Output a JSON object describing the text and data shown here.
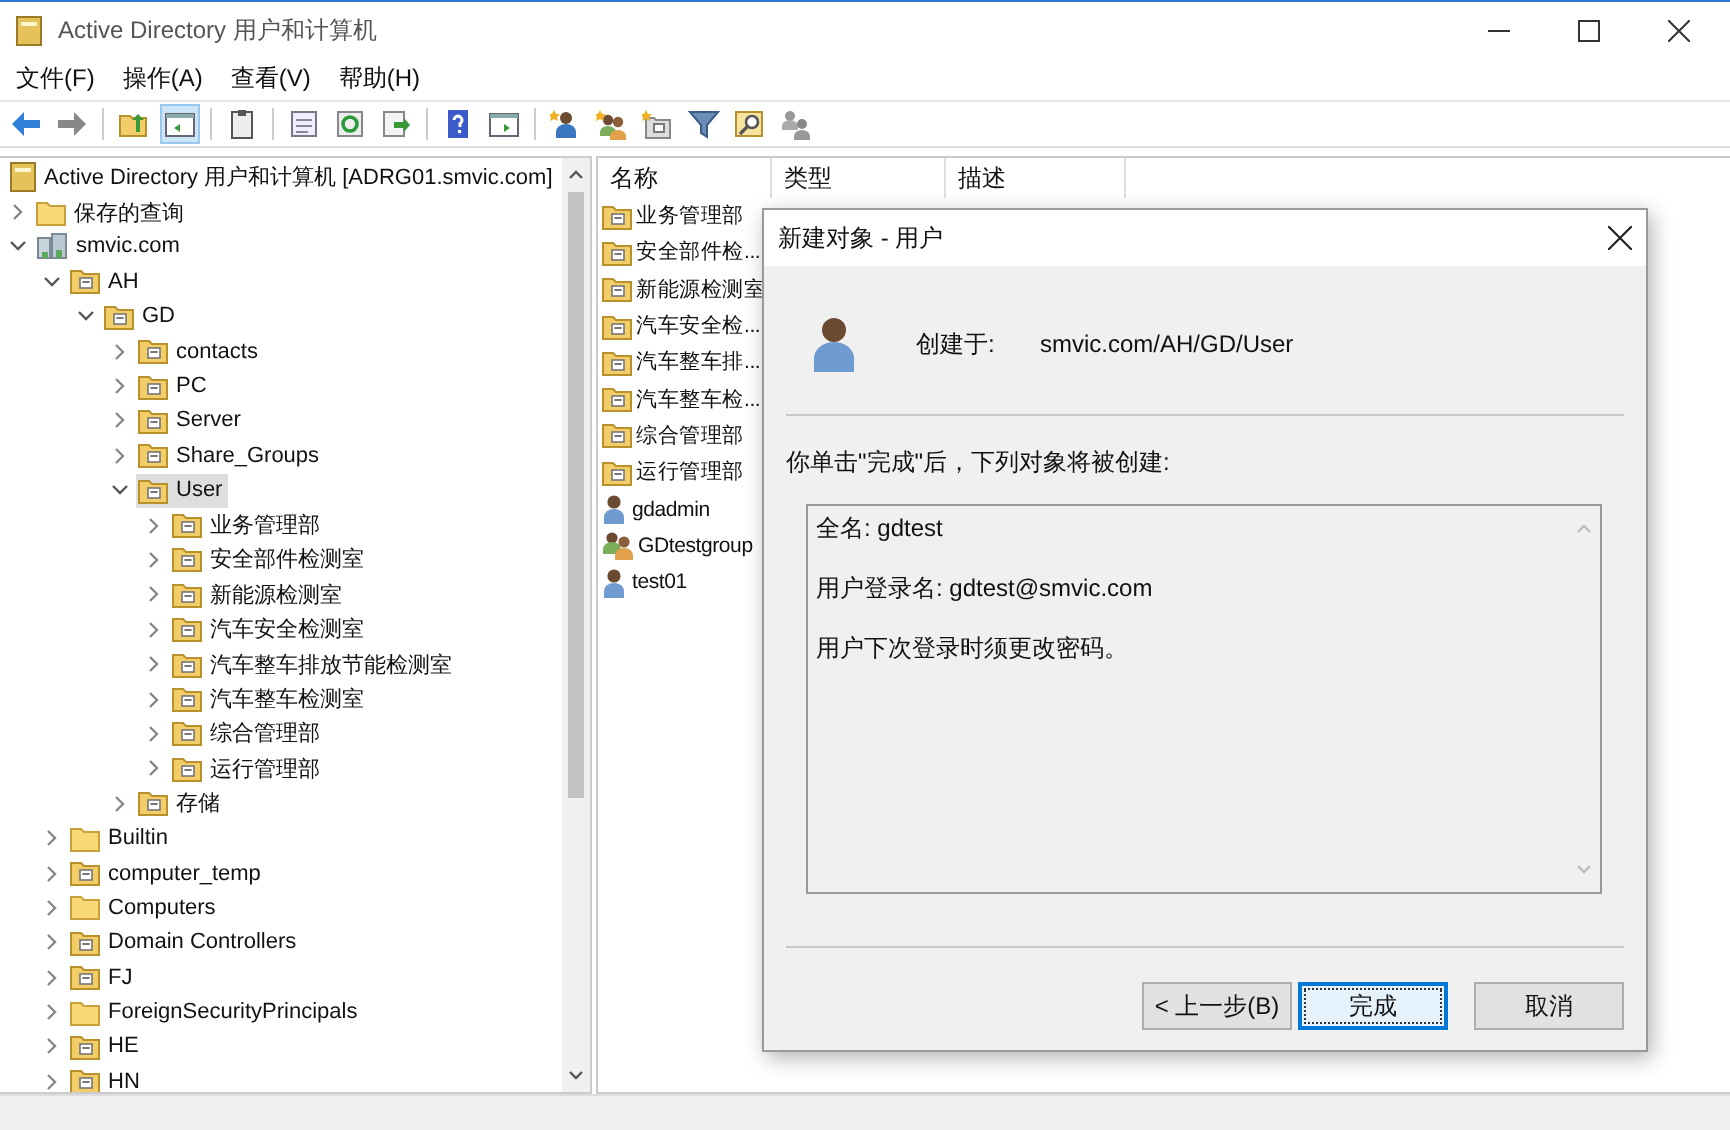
{
  "window": {
    "title": "Active Directory 用户和计算机"
  },
  "menu": [
    "文件(F)",
    "操作(A)",
    "查看(V)",
    "帮助(H)"
  ],
  "toolbar": [
    {
      "kind": "back",
      "pressed": false
    },
    {
      "kind": "forward",
      "pressed": false
    },
    {
      "kind": "up",
      "pressed": false
    },
    {
      "kind": "tree",
      "pressed": true
    },
    {
      "kind": "clipboard",
      "pressed": false
    },
    {
      "kind": "properties",
      "pressed": false
    },
    {
      "kind": "refresh",
      "pressed": false
    },
    {
      "kind": "export",
      "pressed": false
    },
    {
      "kind": "help",
      "pressed": false
    },
    {
      "kind": "pane",
      "pressed": false
    },
    {
      "kind": "adduser",
      "pressed": false
    },
    {
      "kind": "addgroup",
      "pressed": false
    },
    {
      "kind": "addou",
      "pressed": false
    },
    {
      "kind": "filter",
      "pressed": false
    },
    {
      "kind": "find",
      "pressed": false
    },
    {
      "kind": "users",
      "pressed": false
    }
  ],
  "tree": {
    "items": [
      {
        "label": "Active Directory 用户和计算机 [ADRG01.smvic.com]",
        "kind": "root",
        "selected": false,
        "children": [
          {
            "label": "保存的查询",
            "kind": "folder",
            "expanded": false,
            "selected": false
          },
          {
            "label": "smvic.com",
            "kind": "domain",
            "expanded": true,
            "selected": false,
            "children": [
              {
                "label": "AH",
                "kind": "ou",
                "expanded": true,
                "selected": false,
                "children": [
                  {
                    "label": "GD",
                    "kind": "ou",
                    "expanded": true,
                    "selected": false,
                    "children": [
                      {
                        "label": "contacts",
                        "kind": "ou",
                        "expanded": false,
                        "selected": false
                      },
                      {
                        "label": "PC",
                        "kind": "ou",
                        "expanded": false,
                        "selected": false
                      },
                      {
                        "label": "Server",
                        "kind": "ou",
                        "expanded": false,
                        "selected": false
                      },
                      {
                        "label": "Share_Groups",
                        "kind": "ou",
                        "expanded": false,
                        "selected": false
                      },
                      {
                        "label": "User",
                        "kind": "ou",
                        "expanded": true,
                        "selected": true,
                        "children": [
                          {
                            "label": "业务管理部",
                            "kind": "ou",
                            "expanded": false,
                            "selected": false
                          },
                          {
                            "label": "安全部件检测室",
                            "kind": "ou",
                            "expanded": false,
                            "selected": false
                          },
                          {
                            "label": "新能源检测室",
                            "kind": "ou",
                            "expanded": false,
                            "selected": false
                          },
                          {
                            "label": "汽车安全检测室",
                            "kind": "ou",
                            "expanded": false,
                            "selected": false
                          },
                          {
                            "label": "汽车整车排放节能检测室",
                            "kind": "ou",
                            "expanded": false,
                            "selected": false
                          },
                          {
                            "label": "汽车整车检测室",
                            "kind": "ou",
                            "expanded": false,
                            "selected": false
                          },
                          {
                            "label": "综合管理部",
                            "kind": "ou",
                            "expanded": false,
                            "selected": false
                          },
                          {
                            "label": "运行管理部",
                            "kind": "ou",
                            "expanded": false,
                            "selected": false
                          }
                        ]
                      },
                      {
                        "label": "存储",
                        "kind": "ou",
                        "expanded": false,
                        "selected": false
                      }
                    ]
                  }
                ]
              },
              {
                "label": "Builtin",
                "kind": "folder",
                "expanded": false,
                "selected": false
              },
              {
                "label": "computer_temp",
                "kind": "ou",
                "expanded": false,
                "selected": false
              },
              {
                "label": "Computers",
                "kind": "folder",
                "expanded": false,
                "selected": false
              },
              {
                "label": "Domain Controllers",
                "kind": "ou",
                "expanded": false,
                "selected": false
              },
              {
                "label": "FJ",
                "kind": "ou",
                "expanded": false,
                "selected": false
              },
              {
                "label": "ForeignSecurityPrincipals",
                "kind": "folder",
                "expanded": false,
                "selected": false
              },
              {
                "label": "HE",
                "kind": "ou",
                "expanded": false,
                "selected": false
              },
              {
                "label": "HN",
                "kind": "ou",
                "expanded": false,
                "selected": false
              }
            ]
          }
        ]
      }
    ]
  },
  "list": {
    "columns": [
      "名称",
      "类型",
      "描述"
    ],
    "rows": [
      {
        "name": "业务管理部",
        "kind": "ou"
      },
      {
        "name": "安全部件检...",
        "kind": "ou"
      },
      {
        "name": "新能源检测室",
        "kind": "ou"
      },
      {
        "name": "汽车安全检...",
        "kind": "ou"
      },
      {
        "name": "汽车整车排...",
        "kind": "ou"
      },
      {
        "name": "汽车整车检...",
        "kind": "ou"
      },
      {
        "name": "综合管理部",
        "kind": "ou"
      },
      {
        "name": "运行管理部",
        "kind": "ou"
      },
      {
        "name": "gdadmin",
        "kind": "user"
      },
      {
        "name": "GDtestgroup",
        "kind": "group"
      },
      {
        "name": "test01",
        "kind": "user"
      }
    ]
  },
  "dialog": {
    "title": "新建对象 - 用户",
    "created_in_label": "创建于:",
    "created_in_path": "smvic.com/AH/GD/User",
    "intro": "你单击\"完成\"后，下列对象将被创建:",
    "summary": [
      "全名: gdtest",
      "用户登录名: gdtest@smvic.com",
      "用户下次登录时须更改密码。"
    ],
    "buttons": [
      {
        "label": "< 上一步(B)",
        "default": false
      },
      {
        "label": "完成",
        "default": true
      },
      {
        "label": "取消",
        "default": false
      }
    ]
  }
}
